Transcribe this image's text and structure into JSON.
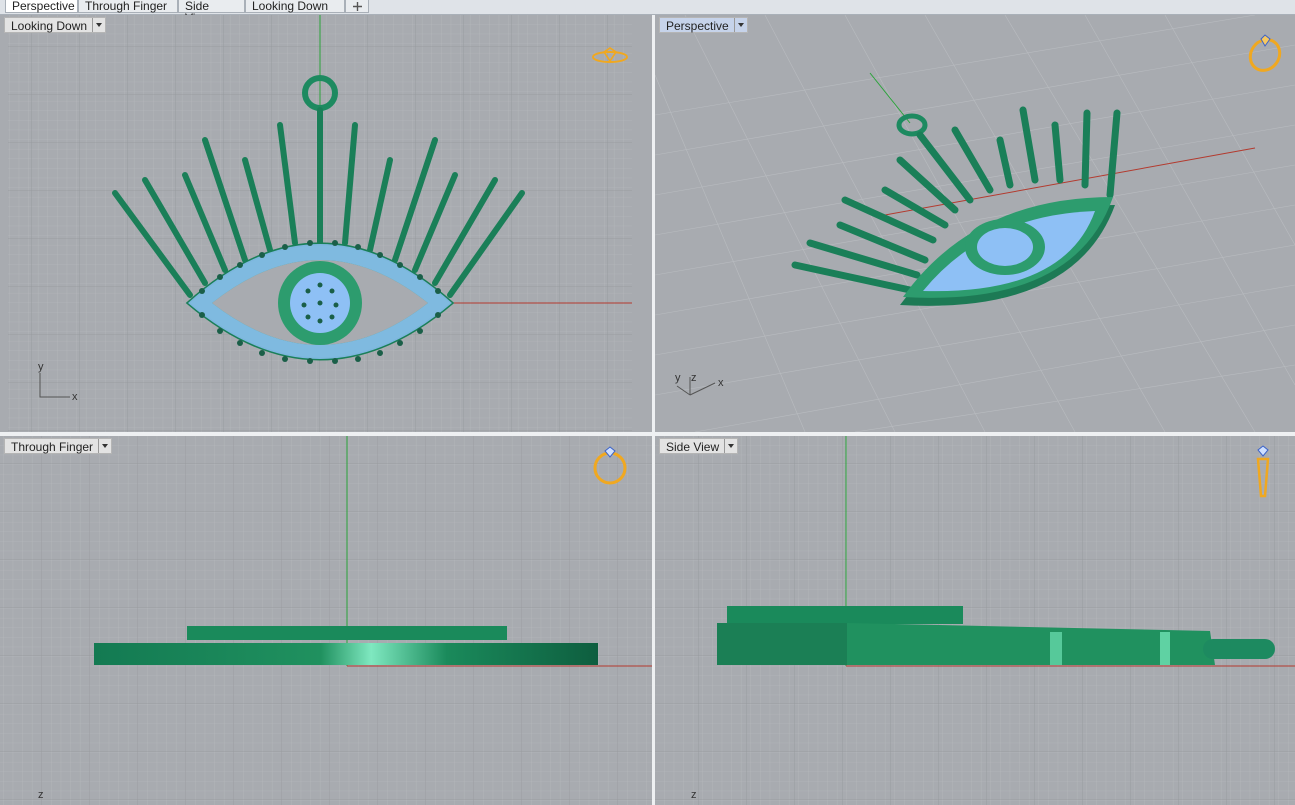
{
  "tabs": [
    {
      "label": "Perspective",
      "active": true
    },
    {
      "label": "Through Finger",
      "active": false
    },
    {
      "label": "Side View",
      "active": false
    },
    {
      "label": "Looking Down",
      "active": false
    }
  ],
  "viewports": {
    "top_left": {
      "title": "Looking Down",
      "active": false,
      "axis_x": "x",
      "axis_y": "y",
      "nav_icon": "ring-top-icon"
    },
    "top_right": {
      "title": "Perspective",
      "active": true,
      "axis_x": "x",
      "axis_y": "y",
      "axis_z": "z",
      "nav_icon": "ring-perspective-icon"
    },
    "bottom_left": {
      "title": "Through Finger",
      "active": false,
      "axis_z": "z",
      "nav_icon": "ring-front-icon"
    },
    "bottom_right": {
      "title": "Side View",
      "active": false,
      "axis_z": "z",
      "nav_icon": "ring-side-icon"
    }
  },
  "colors": {
    "grid_bg": "#a8abb0",
    "metal": "#1f8f62",
    "gem": "#9cc7ff",
    "nav_icon": "#f0a820",
    "active_title": "#c6d3ea"
  }
}
